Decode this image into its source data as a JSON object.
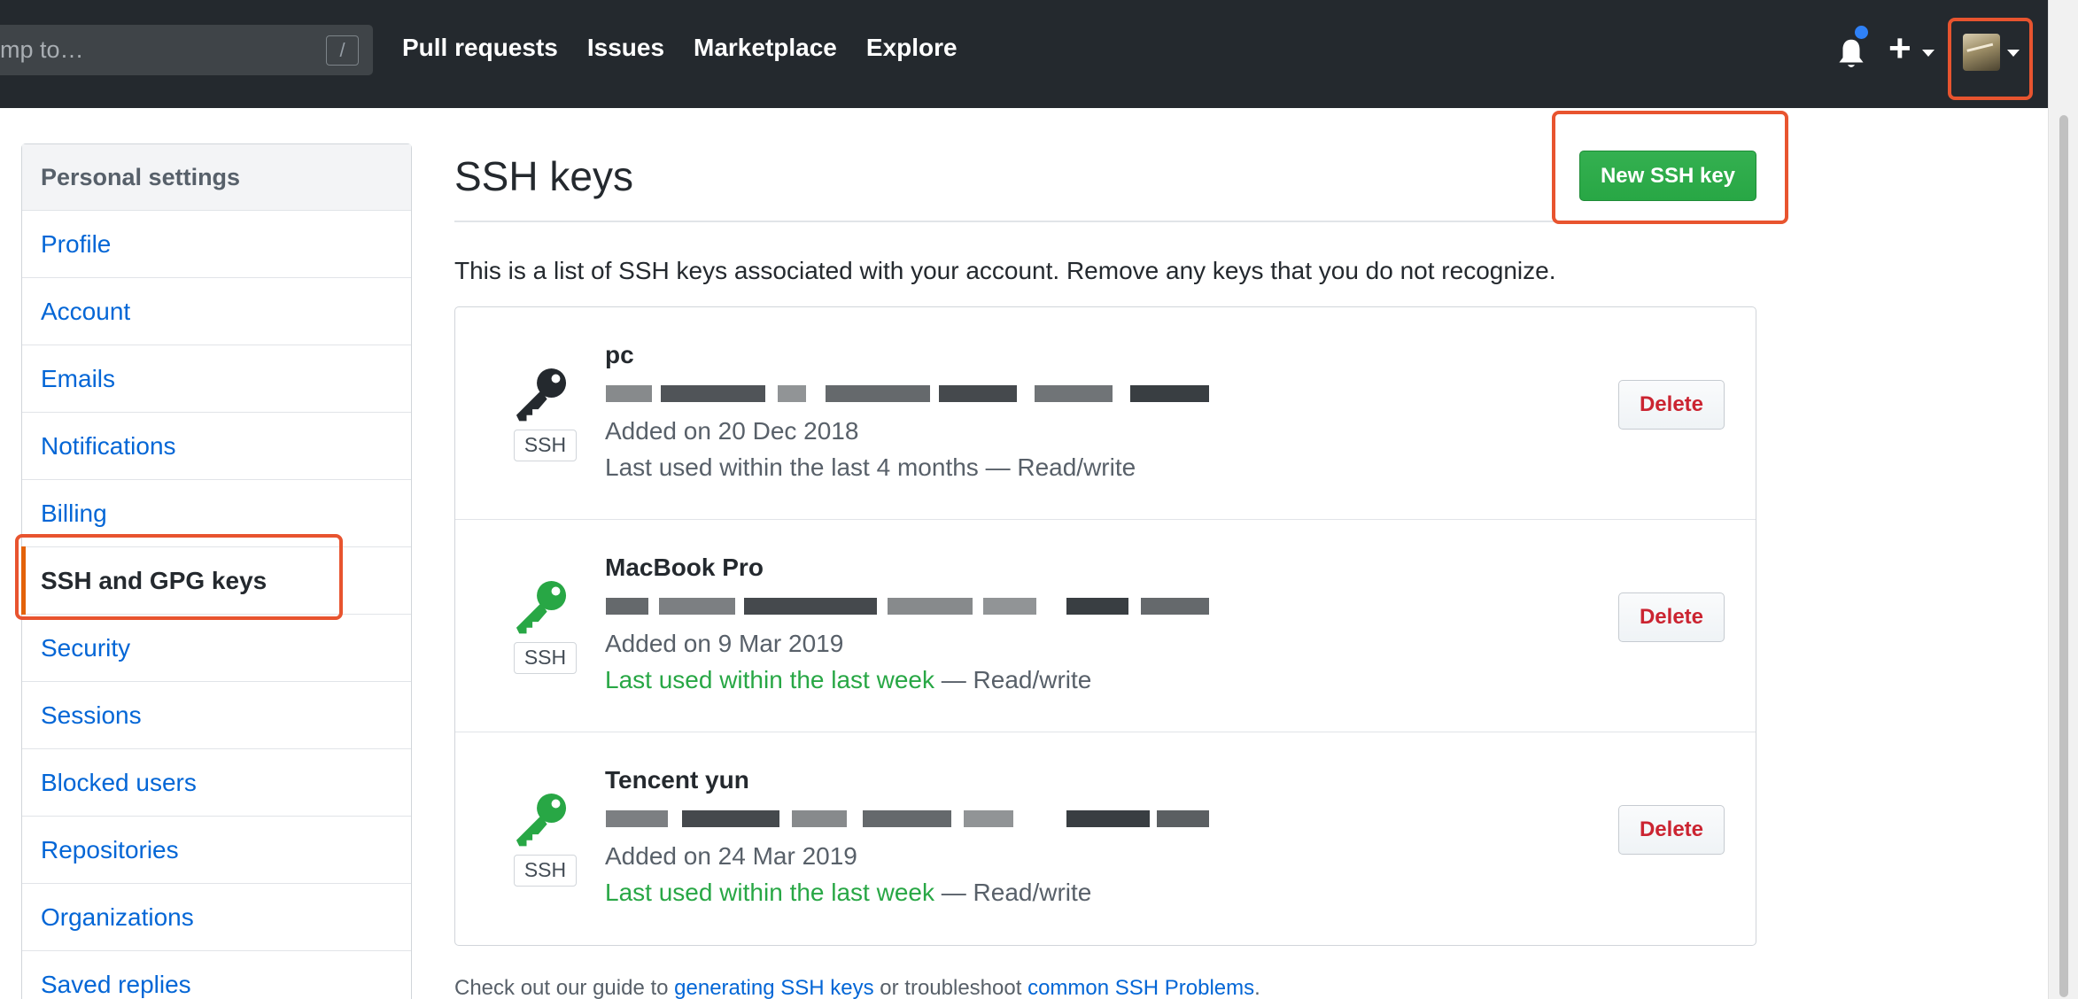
{
  "header": {
    "search": {
      "placeholder": "mp to…",
      "shortcut": "/"
    },
    "nav": [
      "Pull requests",
      "Issues",
      "Marketplace",
      "Explore"
    ],
    "icons": {
      "notifications": "bell-icon",
      "create": "plus-icon",
      "avatar": "user-avatar"
    },
    "plus_symbol": "+",
    "notification_dot_color": "#2f81f7"
  },
  "sidebar": {
    "heading": "Personal settings",
    "items": [
      {
        "label": "Profile"
      },
      {
        "label": "Account"
      },
      {
        "label": "Emails"
      },
      {
        "label": "Notifications"
      },
      {
        "label": "Billing"
      },
      {
        "label": "SSH and GPG keys",
        "selected": true
      },
      {
        "label": "Security"
      },
      {
        "label": "Sessions"
      },
      {
        "label": "Blocked users"
      },
      {
        "label": "Repositories"
      },
      {
        "label": "Organizations"
      },
      {
        "label": "Saved replies"
      }
    ]
  },
  "main": {
    "title": "SSH keys",
    "new_key_button": "New SSH key",
    "intro": "This is a list of SSH keys associated with your account. Remove any keys that you do not recognize.",
    "keys": [
      {
        "title": "pc",
        "badge": "SSH",
        "added": "Added on 20 Dec 2018",
        "last_used": "Last used within the last 4 months",
        "access": " — Read/write",
        "recent": false,
        "icon_color": "#24292e",
        "delete_label": "Delete"
      },
      {
        "title": "MacBook Pro",
        "badge": "SSH",
        "added": "Added on 9 Mar 2019",
        "last_used": "Last used within the last week",
        "access": " — Read/write",
        "recent": true,
        "icon_color": "#28a745",
        "delete_label": "Delete"
      },
      {
        "title": "Tencent yun",
        "badge": "SSH",
        "added": "Added on 24 Mar 2019",
        "last_used": "Last used within the last week",
        "access": " — Read/write",
        "recent": true,
        "icon_color": "#28a745",
        "delete_label": "Delete"
      }
    ],
    "footer": {
      "prefix": "Check out our guide to ",
      "link1": "generating SSH keys",
      "middle": " or troubleshoot ",
      "link2": "common SSH Problems",
      "suffix": "."
    }
  },
  "colors": {
    "header_bg": "#24292e",
    "link": "#0366d6",
    "primary_button": "#28a745",
    "danger": "#cb2431",
    "highlight": "#e8542f",
    "selected_marker": "#e36209"
  }
}
